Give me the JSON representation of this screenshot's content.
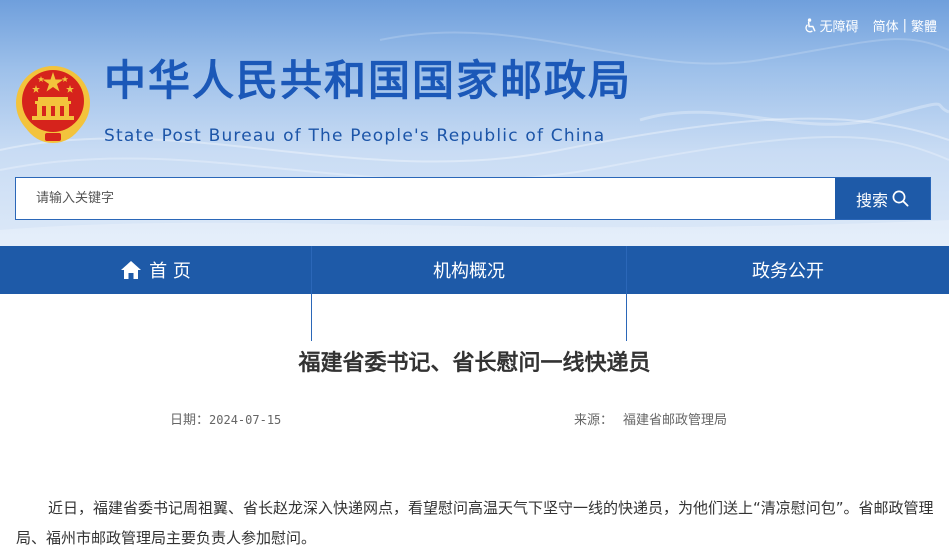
{
  "header": {
    "accessibility_label": "无障碍",
    "lang_simplified": "简体",
    "lang_separator": "|",
    "lang_traditional": "繁體",
    "title": "中华人民共和国国家邮政局",
    "subtitle": "State Post Bureau of The People's Republic of China",
    "emblem_icon": "national-emblem-icon"
  },
  "search": {
    "placeholder": "请输入关键字",
    "button_label": "搜索",
    "button_icon": "search-icon"
  },
  "nav": {
    "items": [
      {
        "label": "首 页",
        "icon": "home-icon"
      },
      {
        "label": "机构概况"
      },
      {
        "label": "政务公开"
      }
    ]
  },
  "article": {
    "title": "福建省委书记、省长慰问一线快递员",
    "date_label": "日期：",
    "date": "2024-07-15",
    "source_label": "来源：",
    "source": "福建省邮政管理局",
    "body": "近日，福建省委书记周祖翼、省长赵龙深入快递网点，看望慰问高温天气下坚守一线的快递员，为他们送上“清凉慰问包”。省邮政管理局、福州市邮政管理局主要负责人参加慰问。"
  },
  "colors": {
    "brand_blue": "#1e5aa8",
    "title_blue": "#1b58b8",
    "emblem_red": "#d6231c",
    "emblem_gold": "#f3c33c"
  }
}
